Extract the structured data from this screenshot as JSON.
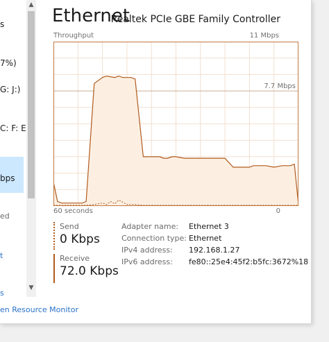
{
  "left_list": {
    "items": [
      {
        "text": "s",
        "top": 28
      },
      {
        "text": "7%)",
        "top": 84
      },
      {
        "text": "G: J:)",
        "top": 122
      },
      {
        "text": "C: F: E",
        "top": 178
      }
    ],
    "selected_text": "bps",
    "sub_text": "ed",
    "links": [
      "t",
      "s"
    ]
  },
  "header": {
    "title": "Ethernet",
    "adapter_model": "Realtek PCIe GBE Family Controller"
  },
  "chart": {
    "top_left_label": "Throughput",
    "max_label": "11 Mbps",
    "ref_label": "7.7 Mbps",
    "bottom_left_label": "60 seconds",
    "bottom_right_label": "0"
  },
  "chart_data": {
    "type": "area",
    "title": "",
    "xlabel": "",
    "ylabel": "Throughput",
    "xlim": [
      60,
      0
    ],
    "ylim": [
      0,
      11
    ],
    "grid": true,
    "reference_line": 7.7,
    "series": [
      {
        "name": "Receive",
        "style": "solid",
        "x": [
          60,
          59,
          58,
          56,
          54,
          53,
          52,
          50,
          48,
          47,
          45,
          44,
          43,
          41,
          40,
          38,
          37,
          36,
          34,
          33,
          32,
          31,
          30,
          28,
          26,
          24,
          22,
          20,
          18,
          16,
          14,
          13,
          12,
          11,
          10,
          8,
          6,
          4,
          2,
          1,
          0
        ],
        "values": [
          1.6,
          0.3,
          0.2,
          0.2,
          0.2,
          0.2,
          0.3,
          8.2,
          8.6,
          8.7,
          8.6,
          8.7,
          8.6,
          8.6,
          8.5,
          3.3,
          3.3,
          3.3,
          3.3,
          3.2,
          3.2,
          3.3,
          3.3,
          3.2,
          3.2,
          3.2,
          3.2,
          3.2,
          3.2,
          2.6,
          2.6,
          2.6,
          2.6,
          2.7,
          2.7,
          2.7,
          2.6,
          2.7,
          2.7,
          2.8,
          0.1
        ]
      },
      {
        "name": "Send",
        "style": "dotted",
        "x": [
          60,
          57,
          54,
          52,
          50,
          48,
          47,
          46,
          45,
          44,
          42,
          40,
          38,
          30,
          20,
          10,
          0
        ],
        "values": [
          0.05,
          0.05,
          0.05,
          0.05,
          0.1,
          0.2,
          0.1,
          0.3,
          0.15,
          0.4,
          0.1,
          0.1,
          0.05,
          0.05,
          0.05,
          0.05,
          0.05
        ]
      }
    ]
  },
  "stats": {
    "send_label": "Send",
    "send_value": "0 Kbps",
    "receive_label": "Receive",
    "receive_value": "72.0 Kbps"
  },
  "details": [
    {
      "key": "Adapter name:",
      "value": "Ethernet 3"
    },
    {
      "key": "Connection type:",
      "value": "Ethernet"
    },
    {
      "key": "IPv4 address:",
      "value": "192.168.1.27"
    },
    {
      "key": "IPv6 address:",
      "value": "fe80::25e4:45f2:b5fc:3672%18"
    }
  ],
  "footer": {
    "link_text": "en Resource Monitor"
  },
  "colors": {
    "chart_line": "#b05a1c",
    "chart_fill": "#fcefe2",
    "chart_grid": "#f2dfcf",
    "chart_border": "#c07840",
    "link": "#2a72c8"
  },
  "icons": {
    "scroll_up": "▲",
    "scroll_down": "▼"
  }
}
